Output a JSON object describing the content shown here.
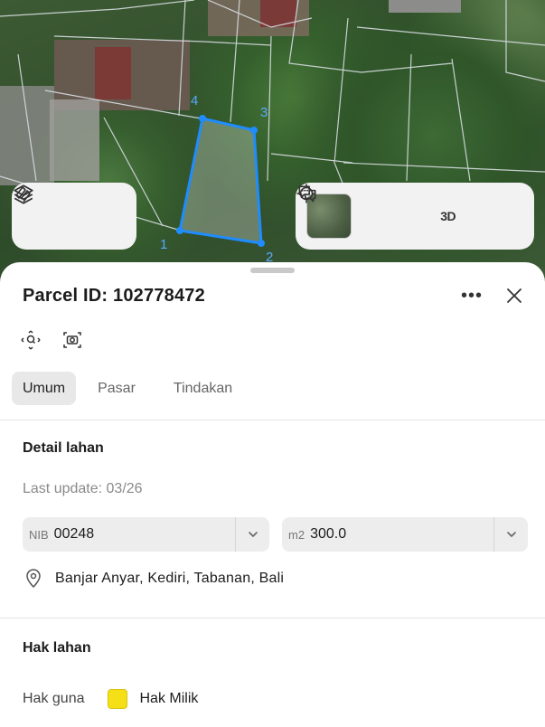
{
  "map": {
    "vertex_labels": [
      "1",
      "2",
      "3",
      "4"
    ],
    "controls_left": {
      "layers_icon": "layers-icon",
      "measure_icon": "measure-icon"
    },
    "controls_right": {
      "basemap_icon": "satellite-thumbnail",
      "locate_icon": "crosshair-icon",
      "view3d_label": "3D",
      "feedback_icon": "chat-icon"
    },
    "accent_color": "#1f8cff"
  },
  "sheet": {
    "title": "Parcel ID: 102778472",
    "tabs": [
      {
        "label": "Umum",
        "active": true
      },
      {
        "label": "Pasar",
        "active": false
      },
      {
        "label": "Tindakan",
        "active": false
      }
    ],
    "detail": {
      "heading": "Detail lahan",
      "last_update": "Last update: 03/26",
      "nib": {
        "label": "NIB",
        "value": "00248"
      },
      "area": {
        "label": "m2",
        "value": "300.0"
      },
      "address": "Banjar Anyar, Kediri, Tabanan, Bali"
    },
    "rights": {
      "heading": "Hak lahan",
      "label": "Hak guna",
      "value": "Hak Milik",
      "swatch_color": "#f5e017"
    }
  }
}
